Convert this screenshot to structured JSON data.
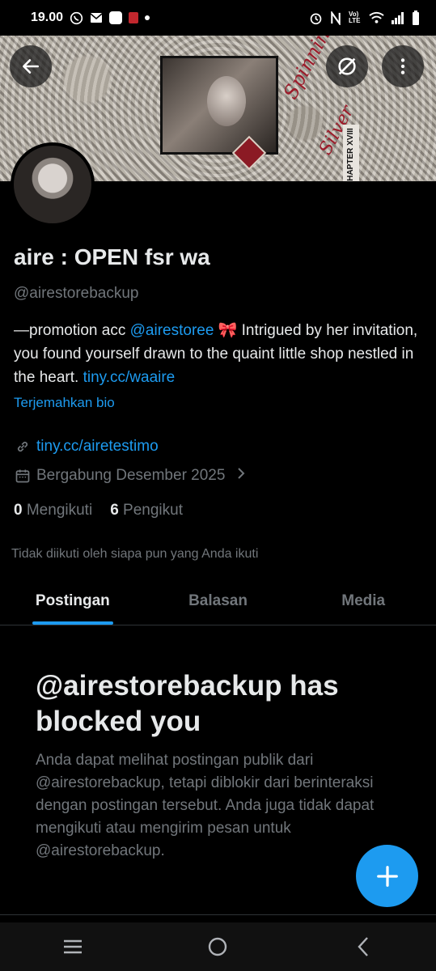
{
  "status_bar": {
    "time": "19.00",
    "icons": [
      "whatsapp-icon",
      "mail-icon",
      "app-icon",
      "news-icon",
      "dot-icon",
      "alarm-icon",
      "nfc-icon",
      "volte-icon",
      "wifi-icon",
      "signal-icon",
      "battery-icon"
    ],
    "volte_label": "Vo) LTE"
  },
  "banner": {
    "script_line1": "Spinning",
    "script_line2": "Silver",
    "chapter_label": "CHAPTER XVIII"
  },
  "header": {
    "back_icon": "back-arrow-icon",
    "grok_icon": "grok-icon",
    "more_icon": "more-vertical-icon"
  },
  "profile": {
    "display_name": "aire : OPEN fsr wa",
    "handle": "@airestorebackup",
    "bio_prefix": "—promotion acc ",
    "bio_mention": "@airestoree",
    "bio_emoji": " 🎀 ",
    "bio_text": "Intrigued by her invitation, you found yourself drawn to the quaint little shop nestled in the heart. ",
    "bio_link": "tiny.cc/waaire",
    "translate_label": "Terjemahkan bio",
    "website": "tiny.cc/airetestimo",
    "joined": "Bergabung Desember 2025",
    "following_count": "0",
    "following_label": "Mengikuti",
    "followers_count": "6",
    "followers_label": "Pengikut",
    "not_followed_text": "Tidak diikuti oleh siapa pun yang Anda ikuti"
  },
  "tabs": [
    {
      "label": "Postingan",
      "active": true
    },
    {
      "label": "Balasan",
      "active": false
    },
    {
      "label": "Media",
      "active": false
    }
  ],
  "blocked": {
    "title": "@airestorebackup has blocked you",
    "description": "Anda dapat melihat postingan publik dari @airestorebackup, tetapi diblokir dari berinteraksi dengan postingan tersebut. Anda juga tidak dapat mengikuti atau mengirim pesan untuk @airestorebackup."
  },
  "fab": {
    "icon": "plus-icon"
  },
  "nav": {
    "icons": [
      "recents-icon",
      "home-icon",
      "back-icon"
    ]
  },
  "colors": {
    "accent": "#1d9bf0",
    "muted": "#71767b",
    "text": "#e7e9ea",
    "background": "#000000"
  }
}
